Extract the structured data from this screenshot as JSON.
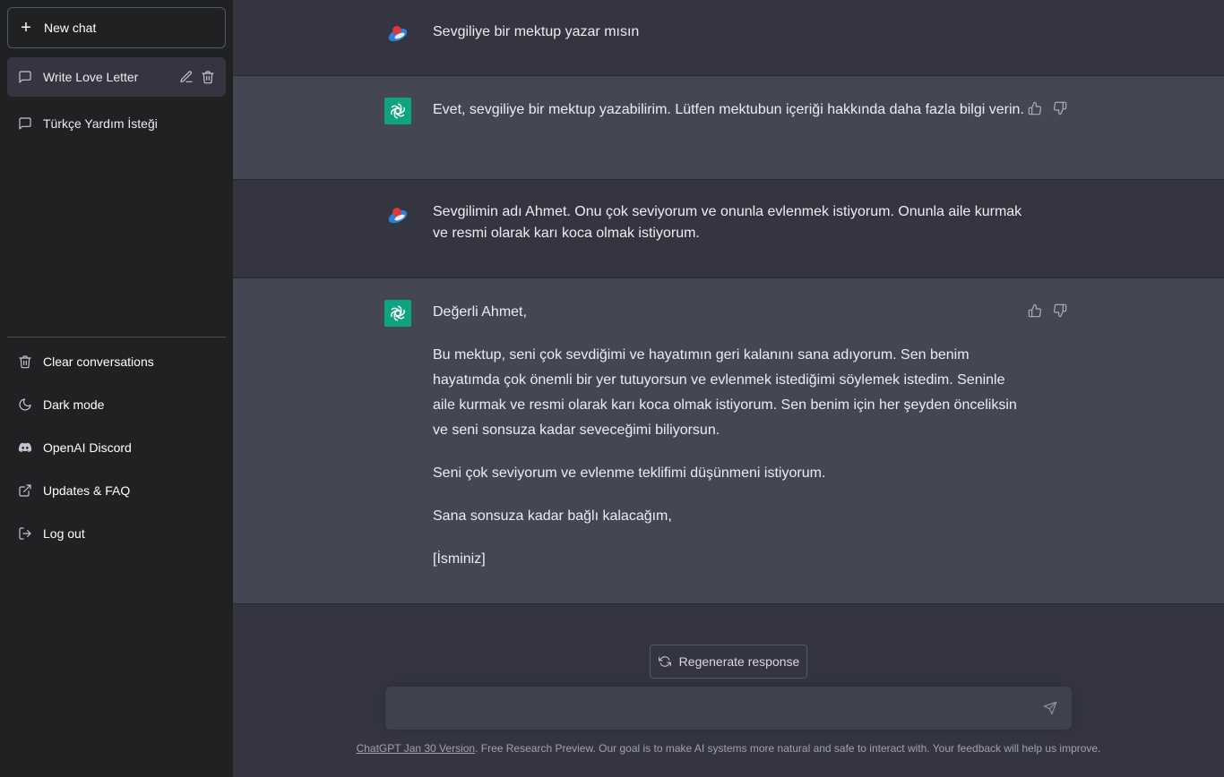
{
  "sidebar": {
    "new_chat_label": "New chat",
    "conversations": [
      {
        "title": "Write Love Letter",
        "active": true
      },
      {
        "title": "Türkçe Yardım İsteği",
        "active": false
      }
    ],
    "menu": [
      {
        "label": "Clear conversations",
        "icon": "trash-icon"
      },
      {
        "label": "Dark mode",
        "icon": "moon-icon"
      },
      {
        "label": "OpenAI Discord",
        "icon": "discord-icon"
      },
      {
        "label": "Updates & FAQ",
        "icon": "external-link-icon"
      },
      {
        "label": "Log out",
        "icon": "logout-icon"
      }
    ]
  },
  "messages": [
    {
      "role": "user",
      "paragraphs": [
        "Sevgiliye bir mektup yazar mısın"
      ]
    },
    {
      "role": "assistant",
      "paragraphs": [
        "Evet, sevgiliye bir mektup yazabilirim. Lütfen mektubun içeriği hakkında daha fazla bilgi verin."
      ]
    },
    {
      "role": "user",
      "paragraphs": [
        "Sevgilimin adı Ahmet. Onu çok seviyorum ve onunla evlenmek istiyorum. Onunla aile kurmak ve resmi olarak karı koca olmak istiyorum."
      ]
    },
    {
      "role": "assistant",
      "paragraphs": [
        "Değerli Ahmet,",
        "Bu mektup, seni çok sevdiğimi ve hayatımın geri kalanını sana adıyorum. Sen benim hayatımda çok önemli bir yer tutuyorsun ve evlenmek istediğimi söylemek istedim. Seninle aile kurmak ve resmi olarak karı koca olmak istiyorum. Sen benim için her şeyden önceliksin ve seni sonsuza kadar seveceğimi biliyorsun.",
        "Seni çok seviyorum ve evlenme teklifimi düşünmeni istiyorum.",
        "Sana sonsuza kadar bağlı kalacağım,",
        "[İsminiz]"
      ]
    }
  ],
  "composer": {
    "regenerate_label": "Regenerate response",
    "input_value": "",
    "placeholder": ""
  },
  "footer": {
    "version_link": "ChatGPT Jan 30 Version",
    "text": ". Free Research Preview. Our goal is to make AI systems more natural and safe to interact with. Your feedback will help us improve."
  },
  "colors": {
    "sidebar_bg": "#202123",
    "user_bg": "#343541",
    "assistant_bg": "#444654",
    "gpt_accent": "#10a37f"
  }
}
